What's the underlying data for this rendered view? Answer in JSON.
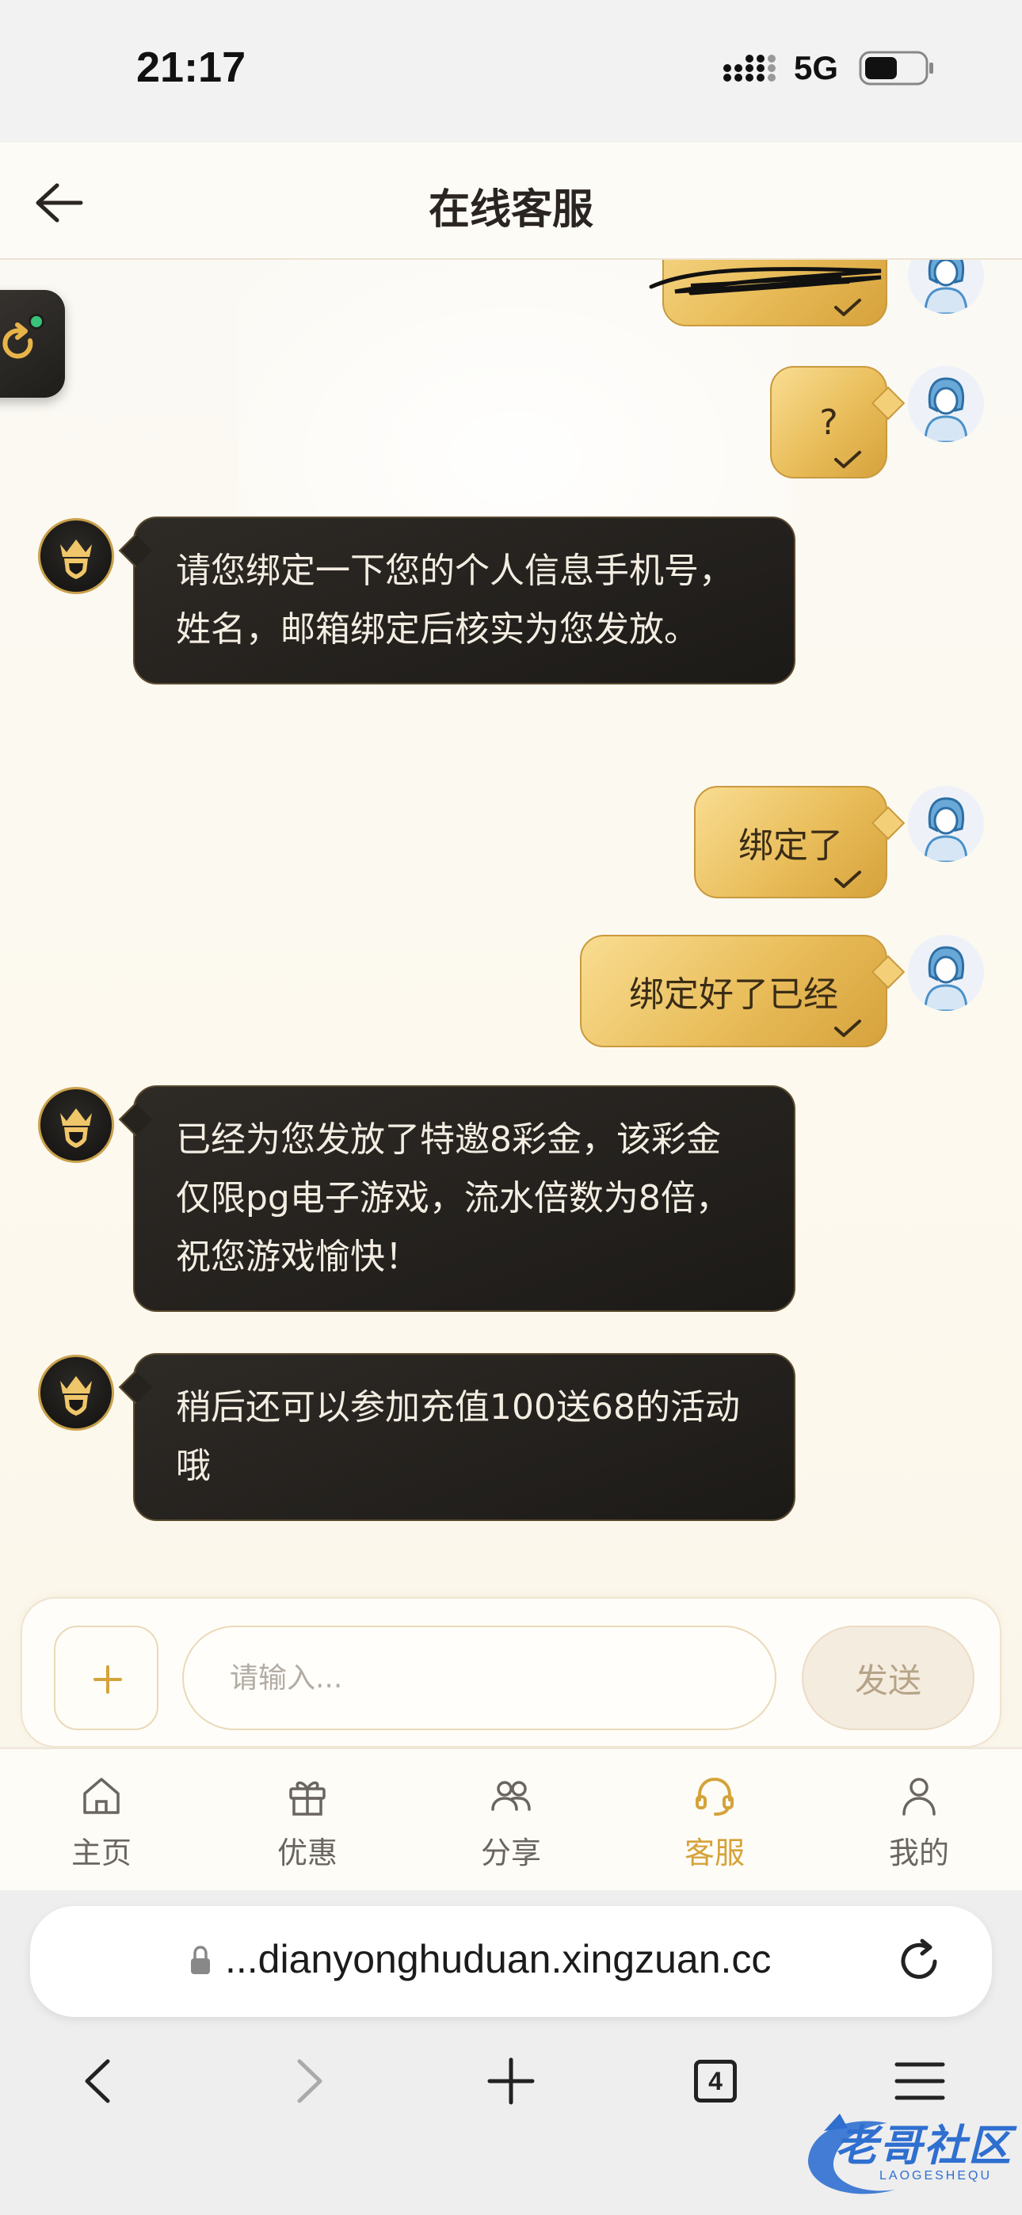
{
  "status_bar": {
    "time": "21:17",
    "network": "5G"
  },
  "header": {
    "title": "在线客服"
  },
  "messages": {
    "out_question": "?",
    "in_1": "请您绑定一下您的个人信息手机号，姓名，邮箱绑定后核实为您发放。",
    "out_bound": "绑定了",
    "out_bound_already": "绑定好了已经",
    "in_2": "已经为您发放了特邀8彩金，该彩金仅限pg电子游戏，流水倍数为8倍，祝您游戏愉快！",
    "in_3": "稍后还可以参加充值100送68的活动哦"
  },
  "composer": {
    "placeholder": "请输入...",
    "send_label": "发送"
  },
  "nav": {
    "home": "主页",
    "offers": "优惠",
    "share": "分享",
    "support": "客服",
    "mine": "我的",
    "active": "support"
  },
  "browser": {
    "url": "...dianyonghuduan.xingzuan.cc",
    "tab_count": "4"
  },
  "watermark": {
    "title": "老哥社区",
    "subtitle": "LAOGESHEQU"
  },
  "colors": {
    "accent_gold": "#d4a33a",
    "agent_bubble": "#1f1c18",
    "user_bubble": "#e9bd5a"
  }
}
